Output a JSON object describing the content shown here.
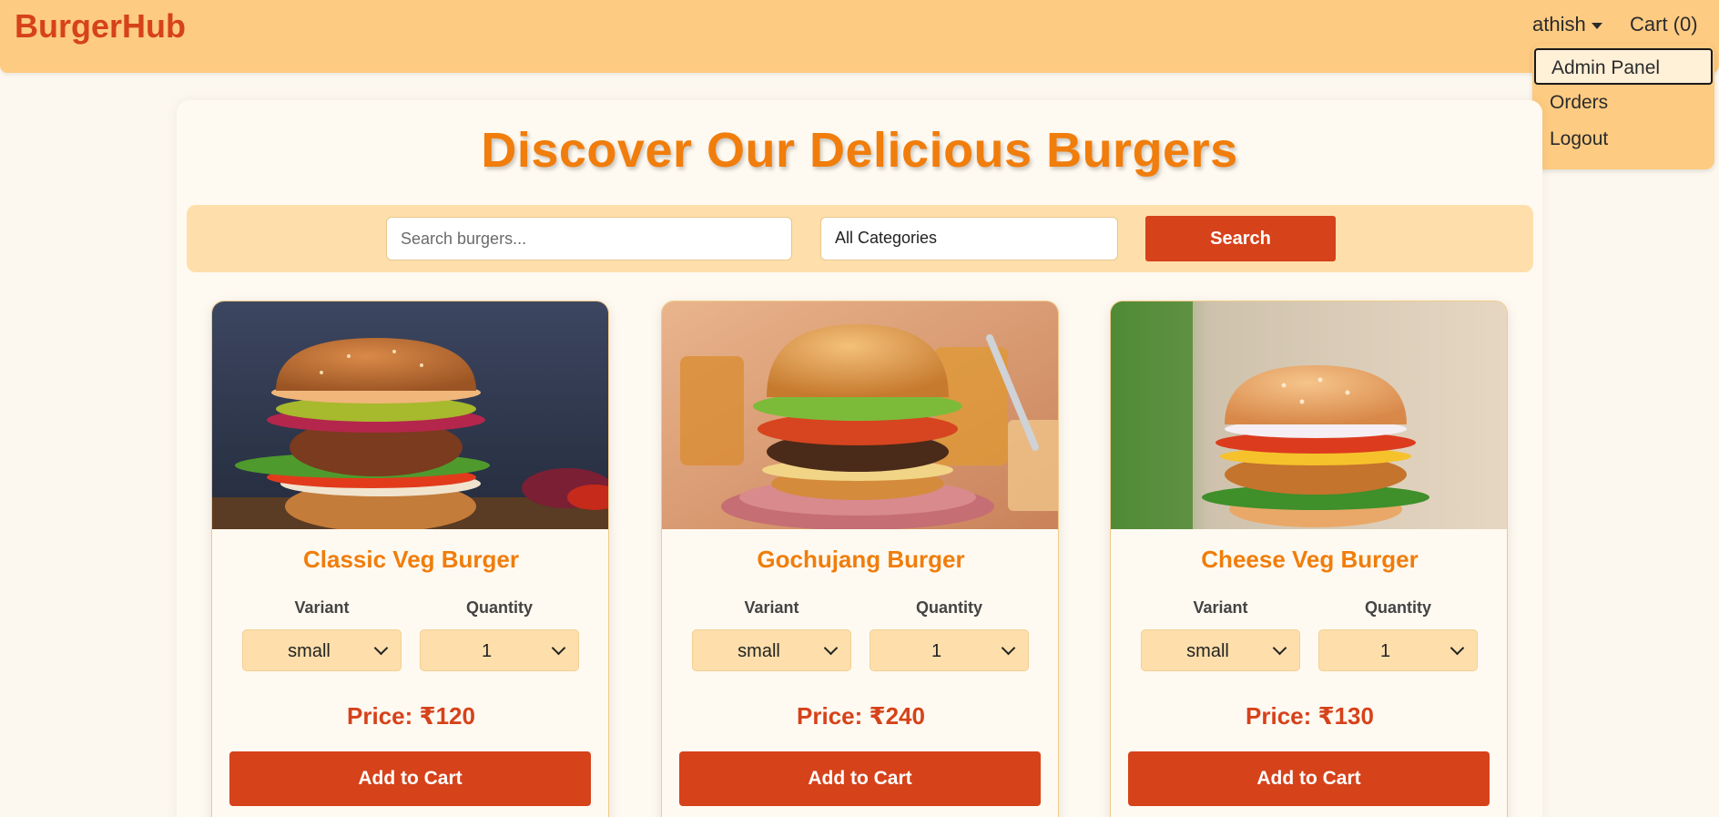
{
  "navbar": {
    "brand": "BurgerHub",
    "user_name": "athish",
    "cart_label": "Cart (0)"
  },
  "user_menu": {
    "items": [
      {
        "label": "Admin Panel"
      },
      {
        "label": "Orders"
      },
      {
        "label": "Logout"
      }
    ]
  },
  "page": {
    "title": "Discover Our Delicious Burgers"
  },
  "search": {
    "placeholder": "Search burgers...",
    "value": "",
    "category_selected": "All Categories",
    "button_label": "Search"
  },
  "card_labels": {
    "variant": "Variant",
    "quantity": "Quantity",
    "add_to_cart": "Add to Cart"
  },
  "products": [
    {
      "name": "Classic Veg Burger",
      "variant": "small",
      "quantity": "1",
      "price": "Price: ₹120"
    },
    {
      "name": "Gochujang Burger",
      "variant": "small",
      "quantity": "1",
      "price": "Price: ₹240"
    },
    {
      "name": "Cheese Veg Burger",
      "variant": "small",
      "quantity": "1",
      "price": "Price: ₹130"
    }
  ],
  "colors": {
    "navbar_bg": "#fecb82",
    "brand": "#d6421a",
    "title": "#f07d0c",
    "button": "#d6421a",
    "page_bg": "#fdf8ef"
  }
}
